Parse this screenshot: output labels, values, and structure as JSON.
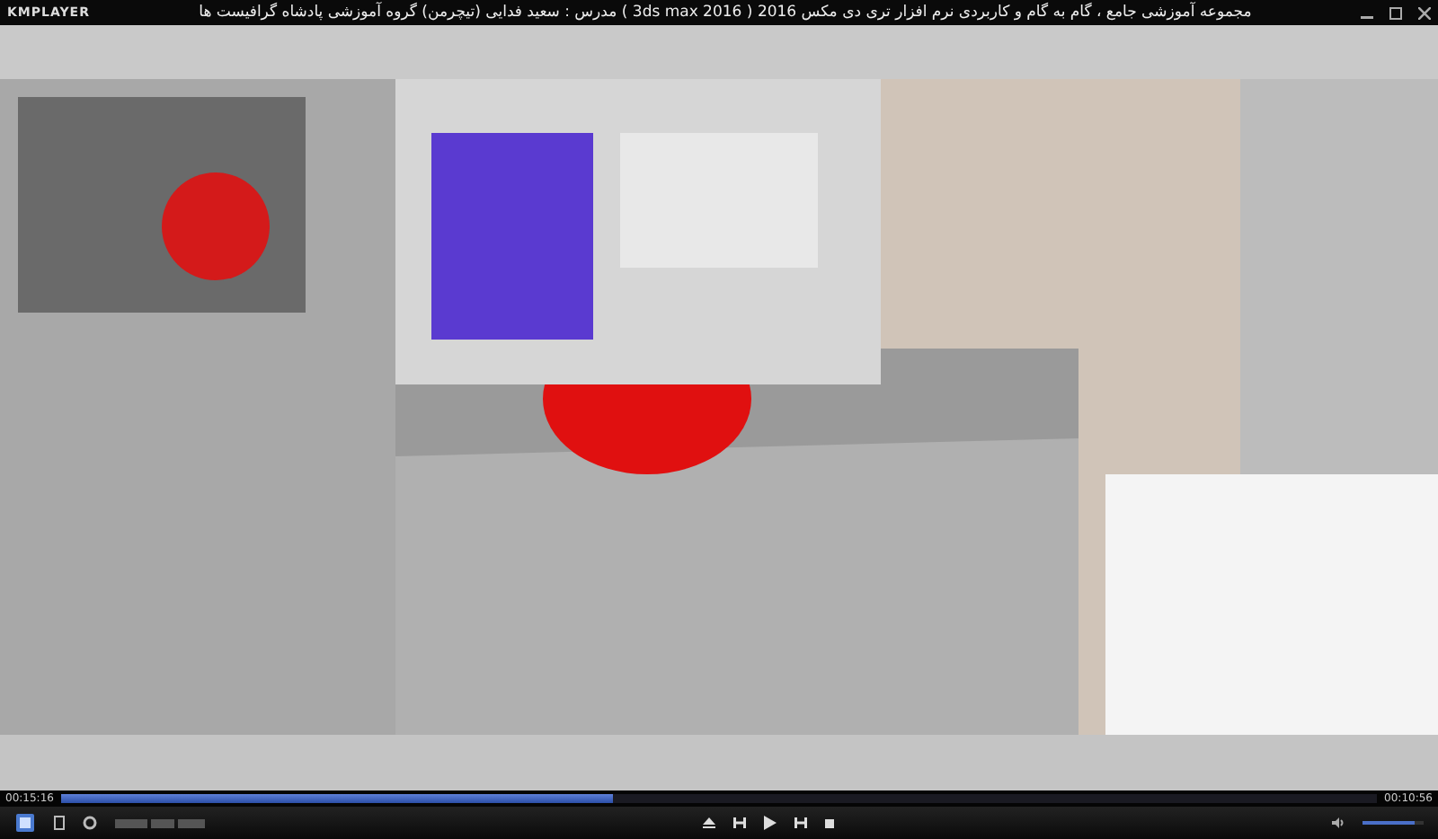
{
  "window": {
    "app_name": "KMPLAYER",
    "title": "مجموعه آموزشی جامع ، گام به گام و کاربردی نرم افزار تری دی مکس 2016 ( 3ds max 2016 )  مدرس : سعید فدایی (تیچرمن) گروه آموزشی پادشاه گرافیست ها"
  },
  "seek_bar": {
    "elapsed": "00:15:16",
    "level": 0.42,
    "remaining": "00:10:56"
  },
  "volume": {
    "level": 0.85
  }
}
